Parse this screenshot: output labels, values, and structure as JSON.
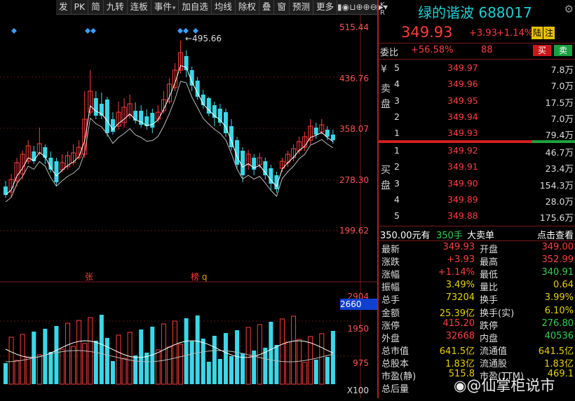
{
  "toolbar": {
    "items": [
      {
        "label": "发",
        "dd": ""
      },
      {
        "label": "PK",
        "dd": ""
      },
      {
        "label": "简",
        "dd": ""
      },
      {
        "label": "九转",
        "dd": ""
      },
      {
        "label": "连板",
        "dd": ""
      },
      {
        "label": "事件",
        "dd": "▾"
      },
      {
        "label": "加自选",
        "dd": ""
      },
      {
        "label": "均线",
        "dd": ""
      },
      {
        "label": "除权",
        "dd": ""
      },
      {
        "label": "叠",
        "dd": ""
      },
      {
        "label": "窗",
        "dd": ""
      },
      {
        "label": "预测",
        "dd": ""
      },
      {
        "label": "更多",
        "dd": ""
      }
    ]
  },
  "chart": {
    "price_ticks": [
      "515.44",
      "436.76",
      "358.07",
      "278.30",
      "199.62"
    ],
    "high_label": "495.66",
    "markers": {
      "zhang": "张",
      "bang": "榜",
      "q": "q"
    },
    "volume_ticks": [
      "2904",
      "1950",
      "975",
      "X100"
    ],
    "volume_highlight": "2660",
    "colors": {
      "up": "#ff3c3c",
      "down": "#3ad8e8",
      "ma": "#ffffff",
      "grid": "#5a1414"
    }
  },
  "panel": {
    "kr": [
      "K",
      "R"
    ],
    "name": "绿的谐波 688017",
    "price": "349.93",
    "change": "+3.93",
    "change_pct": "+1.14%",
    "tags": [
      "陆",
      "注"
    ],
    "weibi": {
      "label": "委比",
      "value": "+56.58%",
      "count": "88",
      "buy": "买",
      "sell": "卖"
    },
    "sell_side": "卖盘",
    "buy_side": "买盘",
    "asks": [
      {
        "lvl": "5",
        "price": "349.97",
        "vol": "7.8万"
      },
      {
        "lvl": "4",
        "price": "349.96",
        "vol": "7.0万"
      },
      {
        "lvl": "3",
        "price": "349.95",
        "vol": "17.5万"
      },
      {
        "lvl": "2",
        "price": "349.94",
        "vol": "7.0万"
      },
      {
        "lvl": "1",
        "price": "349.93",
        "vol": "79.4万"
      }
    ],
    "bids": [
      {
        "lvl": "1",
        "price": "349.92",
        "vol": "46.7万"
      },
      {
        "lvl": "2",
        "price": "349.91",
        "vol": "23.4万"
      },
      {
        "lvl": "3",
        "price": "349.90",
        "vol": "154.3万"
      },
      {
        "lvl": "4",
        "price": "349.89",
        "vol": "28.0万"
      },
      {
        "lvl": "5",
        "price": "349.88",
        "vol": "175.6万"
      }
    ],
    "big_order": {
      "price": "350.00元有",
      "hand": "350手",
      "label": "大卖单",
      "link": "点击查看"
    },
    "stats": [
      {
        "l": "最新",
        "v": "349.93",
        "c": "#ff3c3c",
        "l2": "开盘",
        "v2": "349.00",
        "c2": "#ff3c3c"
      },
      {
        "l": "涨跌",
        "v": "+3.93",
        "c": "#ff3c3c",
        "l2": "最高",
        "v2": "352.99",
        "c2": "#ff3c3c"
      },
      {
        "l": "涨幅",
        "v": "+1.14%",
        "c": "#ff3c3c",
        "l2": "最低",
        "v2": "340.91",
        "c2": "#30d050"
      },
      {
        "l": "振幅",
        "v": "3.49%",
        "c": "#e6d200",
        "l2": "量比",
        "v2": "0.64",
        "c2": "#e6d200"
      },
      {
        "l": "总手",
        "v": "73204",
        "c": "#e6d200",
        "l2": "换手",
        "v2": "3.99%",
        "c2": "#e6d200"
      },
      {
        "l": "金额",
        "v": "25.39亿",
        "c": "#e6d200",
        "l2": "换手(实)",
        "v2": "6.10%",
        "c2": "#e6d200"
      },
      {
        "l": "涨停",
        "v": "415.20",
        "c": "#ff3c3c",
        "l2": "跌停",
        "v2": "276.80",
        "c2": "#30d050"
      },
      {
        "l": "外盘",
        "v": "32668",
        "c": "#ff3c3c",
        "l2": "内盘",
        "v2": "40536",
        "c2": "#30d050"
      },
      {
        "l": "总市值",
        "v": "641.5亿",
        "c": "#e6d200",
        "l2": "流通值",
        "v2": "641.5亿",
        "c2": "#e6d200"
      },
      {
        "l": "总股本",
        "v": "1.83亿",
        "c": "#e6d200",
        "l2": "流通股",
        "v2": "1.83亿",
        "c2": "#e6d200"
      },
      {
        "l": "市盈(静)",
        "v": "515.8",
        "c": "#e6d200",
        "l2": "市盈(TTM)",
        "v2": "469.1",
        "c2": "#e6d200"
      },
      {
        "l": "总后量",
        "v": "",
        "c": "#e6d200",
        "l2": "",
        "v2": "",
        "c2": "#e6d200"
      }
    ],
    "watermark": "@仙掌柜说市"
  }
}
